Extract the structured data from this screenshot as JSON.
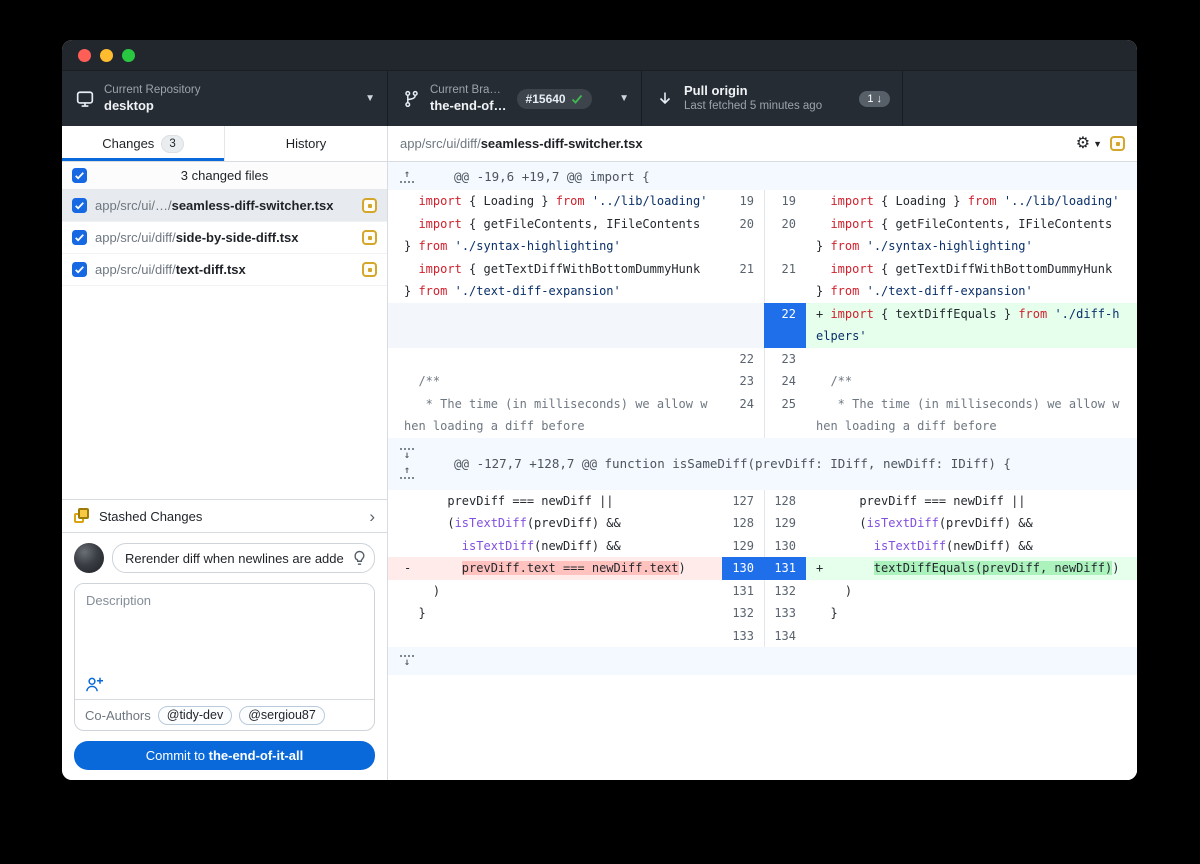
{
  "toolbar": {
    "repo": {
      "label": "Current Repository",
      "value": "desktop"
    },
    "branch": {
      "label": "Current Bra…",
      "value": "the-end-of…",
      "badge": "#15640"
    },
    "pull": {
      "title": "Pull origin",
      "subtitle": "Last fetched 5 minutes ago",
      "badge_count": "1"
    }
  },
  "sidebar": {
    "tabs": [
      {
        "label": "Changes",
        "badge": "3"
      },
      {
        "label": "History"
      }
    ],
    "files_header": "3 changed files",
    "files": [
      {
        "dir": "app/src/ui/…/",
        "name": "seamless-diff-switcher.tsx",
        "selected": true
      },
      {
        "dir": "app/src/ui/diff/",
        "name": "side-by-side-diff.tsx",
        "selected": false
      },
      {
        "dir": "app/src/ui/diff/",
        "name": "text-diff.tsx",
        "selected": false
      }
    ],
    "stashed_label": "Stashed Changes",
    "commit": {
      "summary": "Rerender diff when newlines are adde",
      "description_placeholder": "Description",
      "coauthors_label": "Co-Authors",
      "coauthors": [
        "@tidy-dev",
        "@sergiou87"
      ],
      "button_prefix": "Commit to ",
      "button_branch": "the-end-of-it-all"
    }
  },
  "diff": {
    "path_dir": "app/src/ui/diff/",
    "path_name": "seamless-diff-switcher.tsx",
    "colors": {
      "accent_blue": "#0969da",
      "add_bg": "#e6ffec",
      "del_bg": "#ffebe9",
      "selected_num": "#1f6feb",
      "modified_yellow": "#d4a72c"
    },
    "hunks": [
      {
        "header": "@@ -19,6 +19,7 @@ import {",
        "gutter": [
          "up"
        ],
        "rows": [
          {
            "ln": "19",
            "rn": "19",
            "lt": "ctx",
            "rt": "ctx",
            "l": [
              [
                [
                  "p",
                  "  "
                ],
                [
                  "k",
                  "import"
                ],
                [
                  "p",
                  " { Loading } "
                ],
                [
                  "k",
                  "from"
                ],
                [
                  "p",
                  " "
                ],
                [
                  "s",
                  "'../lib/loading'"
                ]
              ]
            ],
            "r": [
              [
                [
                  "p",
                  "  "
                ],
                [
                  "k",
                  "import"
                ],
                [
                  "p",
                  " { Loading } "
                ],
                [
                  "k",
                  "from"
                ],
                [
                  "p",
                  " "
                ],
                [
                  "s",
                  "'../lib/loading'"
                ]
              ]
            ]
          },
          {
            "ln": "20",
            "rn": "20",
            "lt": "ctx",
            "rt": "ctx",
            "l": [
              [
                [
                  "p",
                  "  "
                ],
                [
                  "k",
                  "import"
                ],
                [
                  "p",
                  " { getFileContents, IFileContents"
                ]
              ],
              [
                [
                  "p",
                  "} "
                ],
                [
                  "k",
                  "from"
                ],
                [
                  "p",
                  " "
                ],
                [
                  "s",
                  "'./syntax-highlighting'"
                ]
              ]
            ],
            "r": [
              [
                [
                  "p",
                  "  "
                ],
                [
                  "k",
                  "import"
                ],
                [
                  "p",
                  " { getFileContents, IFileContents"
                ]
              ],
              [
                [
                  "p",
                  "} "
                ],
                [
                  "k",
                  "from"
                ],
                [
                  "p",
                  " "
                ],
                [
                  "s",
                  "'./syntax-highlighting'"
                ]
              ]
            ]
          },
          {
            "ln": "21",
            "rn": "21",
            "lt": "ctx",
            "rt": "ctx",
            "l": [
              [
                [
                  "p",
                  "  "
                ],
                [
                  "k",
                  "import"
                ],
                [
                  "p",
                  " { getTextDiffWithBottomDummyHunk"
                ]
              ],
              [
                [
                  "p",
                  "} "
                ],
                [
                  "k",
                  "from"
                ],
                [
                  "p",
                  " "
                ],
                [
                  "s",
                  "'./text-diff-expansion'"
                ]
              ]
            ],
            "r": [
              [
                [
                  "p",
                  "  "
                ],
                [
                  "k",
                  "import"
                ],
                [
                  "p",
                  " { getTextDiffWithBottomDummyHunk"
                ]
              ],
              [
                [
                  "p",
                  "} "
                ],
                [
                  "k",
                  "from"
                ],
                [
                  "p",
                  " "
                ],
                [
                  "s",
                  "'./text-diff-expansion'"
                ]
              ]
            ]
          },
          {
            "ln": "",
            "rn": "22",
            "lt": "filler",
            "rt": "add",
            "rsel": true,
            "l": [
              [
                [
                  "p",
                  ""
                ]
              ],
              [
                [
                  "p",
                  ""
                ]
              ]
            ],
            "r": [
              [
                [
                  "p",
                  "+ "
                ],
                [
                  "k",
                  "import"
                ],
                [
                  "p",
                  " { textDiffEquals } "
                ],
                [
                  "k",
                  "from"
                ],
                [
                  "p",
                  " "
                ],
                [
                  "s",
                  "'./diff-h"
                ]
              ],
              [
                [
                  "s",
                  "elpers'"
                ]
              ]
            ]
          },
          {
            "ln": "22",
            "rn": "23",
            "lt": "ctx",
            "rt": "ctx",
            "l": [
              [
                [
                  "p",
                  ""
                ]
              ]
            ],
            "r": [
              [
                [
                  "p",
                  ""
                ]
              ]
            ]
          },
          {
            "ln": "23",
            "rn": "24",
            "lt": "ctx",
            "rt": "ctx",
            "l": [
              [
                [
                  "c",
                  "  /**"
                ]
              ]
            ],
            "r": [
              [
                [
                  "c",
                  "  /**"
                ]
              ]
            ]
          },
          {
            "ln": "24",
            "rn": "25",
            "lt": "ctx",
            "rt": "ctx",
            "l": [
              [
                [
                  "c",
                  "   * The time (in milliseconds) we allow w"
                ]
              ],
              [
                [
                  "c",
                  "hen loading a diff before"
                ]
              ]
            ],
            "r": [
              [
                [
                  "c",
                  "   * The time (in milliseconds) we allow w"
                ]
              ],
              [
                [
                  "c",
                  "hen loading a diff before"
                ]
              ]
            ]
          }
        ]
      },
      {
        "header": "@@ -127,7 +128,7 @@ function isSameDiff(prevDiff: IDiff, newDiff: IDiff) {",
        "gutter": [
          "down",
          "up"
        ],
        "rows": [
          {
            "ln": "127",
            "rn": "128",
            "lt": "ctx",
            "rt": "ctx",
            "l": [
              [
                [
                  "p",
                  "      prevDiff === newDiff ||"
                ]
              ]
            ],
            "r": [
              [
                [
                  "p",
                  "      prevDiff === newDiff ||"
                ]
              ]
            ]
          },
          {
            "ln": "128",
            "rn": "129",
            "lt": "ctx",
            "rt": "ctx",
            "l": [
              [
                [
                  "p",
                  "      ("
                ],
                [
                  "f",
                  "isTextDiff"
                ],
                [
                  "p",
                  "(prevDiff) &&"
                ]
              ]
            ],
            "r": [
              [
                [
                  "p",
                  "      ("
                ],
                [
                  "f",
                  "isTextDiff"
                ],
                [
                  "p",
                  "(prevDiff) &&"
                ]
              ]
            ]
          },
          {
            "ln": "129",
            "rn": "130",
            "lt": "ctx",
            "rt": "ctx",
            "l": [
              [
                [
                  "p",
                  "        "
                ],
                [
                  "f",
                  "isTextDiff"
                ],
                [
                  "p",
                  "(newDiff) &&"
                ]
              ]
            ],
            "r": [
              [
                [
                  "p",
                  "        "
                ],
                [
                  "f",
                  "isTextDiff"
                ],
                [
                  "p",
                  "(newDiff) &&"
                ]
              ]
            ]
          },
          {
            "ln": "130",
            "rn": "131",
            "lt": "del",
            "rt": "add",
            "lsel": true,
            "rsel": true,
            "l": [
              [
                [
                  "p",
                  "-       "
                ],
                [
                  "dh",
                  "prevDiff.text === newDiff.text"
                ],
                [
                  "p",
                  ")"
                ]
              ]
            ],
            "r": [
              [
                [
                  "p",
                  "+       "
                ],
                [
                  "ah",
                  "textDiffEquals(prevDiff, newDiff)"
                ],
                [
                  "p",
                  ")"
                ]
              ]
            ]
          },
          {
            "ln": "131",
            "rn": "132",
            "lt": "ctx",
            "rt": "ctx",
            "l": [
              [
                [
                  "p",
                  "    )"
                ]
              ]
            ],
            "r": [
              [
                [
                  "p",
                  "    )"
                ]
              ]
            ]
          },
          {
            "ln": "132",
            "rn": "133",
            "lt": "ctx",
            "rt": "ctx",
            "l": [
              [
                [
                  "p",
                  "  }"
                ]
              ]
            ],
            "r": [
              [
                [
                  "p",
                  "  }"
                ]
              ]
            ]
          },
          {
            "ln": "133",
            "rn": "134",
            "lt": "ctx",
            "rt": "ctx",
            "l": [
              [
                [
                  "p",
                  ""
                ]
              ]
            ],
            "r": [
              [
                [
                  "p",
                  ""
                ]
              ]
            ]
          }
        ]
      }
    ],
    "bottom_expander_gutter": [
      "down"
    ]
  }
}
